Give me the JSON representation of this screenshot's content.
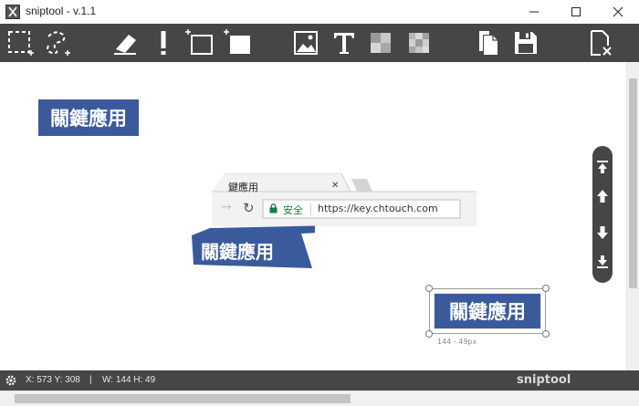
{
  "window": {
    "title": "sniptool - v.1.1"
  },
  "toolbar": {
    "tools": [
      "rect-select-icon",
      "free-select-icon",
      "eraser-icon",
      "marker-icon",
      "add-rect-outline-icon",
      "add-rect-filled-icon",
      "image-icon",
      "text-icon",
      "mosaic-icon",
      "blur-icon",
      "copy-icon",
      "save-icon",
      "close-clip-icon"
    ]
  },
  "canvas": {
    "label_1": "關鍵應用",
    "label_2": "關鍵應用",
    "label_3": "關鍵應用",
    "browser": {
      "tab_title": "鍵應用",
      "tab_close": "✕",
      "secure_text": "安全",
      "url": "https://key.chtouch.com"
    },
    "selection_size": "144 - 49px"
  },
  "status": {
    "coords": "X: 573 Y: 308",
    "separator": "|",
    "dims": "W: 144 H: 49",
    "brand": "sniptool"
  },
  "colors": {
    "toolbar": "#464646",
    "label_blue": "#3a5a9b",
    "secure_green": "#0b8043"
  }
}
